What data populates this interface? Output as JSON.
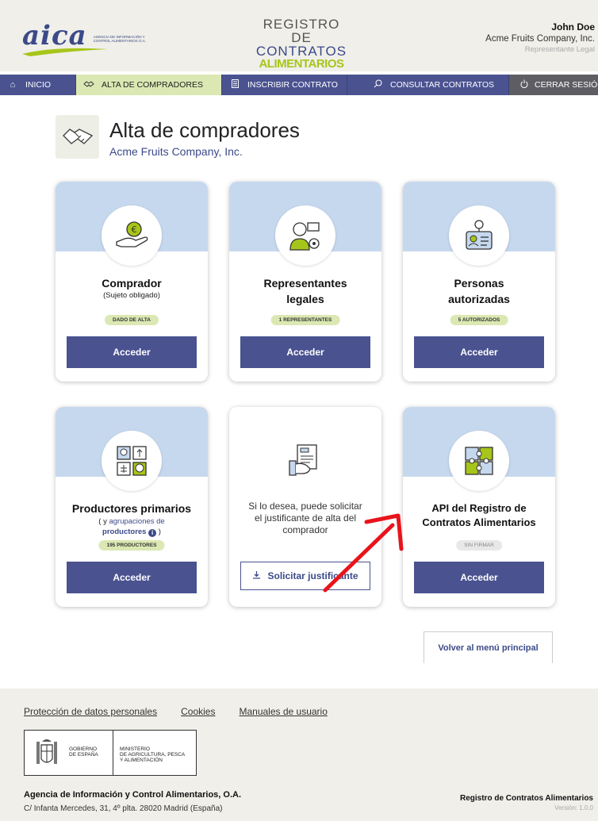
{
  "header": {
    "logo_text": "aica",
    "logo_subtitle": "Agencia de Información y Control Alimentarios O.A.",
    "brand_line1": "REGISTRO DE",
    "brand_line2": "CONTRATOS",
    "brand_line3": "ALIMENTARIOS",
    "user_name": "John Doe",
    "company": "Acme Fruits Company, Inc.",
    "role": "Representante Legal"
  },
  "nav": {
    "items": [
      {
        "label": "INICIO",
        "icon": "home-icon"
      },
      {
        "label": "ALTA DE COMPRADORES",
        "icon": "handshake-icon"
      },
      {
        "label": "INSCRIBIR CONTRATO",
        "icon": "document-icon"
      },
      {
        "label": "CONSULTAR CONTRATOS",
        "icon": "search-icon"
      },
      {
        "label": "CERRAR SESIÓN",
        "icon": "power-icon"
      }
    ]
  },
  "page": {
    "title": "Alta de compradores",
    "subtitle": "Acme Fruits Company, Inc."
  },
  "cards": {
    "comprador": {
      "title": "Comprador",
      "subtitle": "(Sujeto obligado)",
      "badge": "DADO DE ALTA",
      "button": "Acceder"
    },
    "representantes": {
      "title_line1": "Representantes",
      "title_line2": "legales",
      "badge": "1 REPRESENTANTES",
      "button": "Acceder"
    },
    "personas": {
      "title_line1": "Personas",
      "title_line2": "autorizadas",
      "badge": "5 AUTORIZADOS",
      "button": "Acceder"
    },
    "productores": {
      "title": "Productores primarios",
      "sub_prefix": "( y ",
      "sub_link1": "agrupaciones de",
      "sub_link2": "productores",
      "sub_suffix": " )",
      "badge": "195 PRODUCTORES",
      "button": "Acceder"
    },
    "justificante": {
      "text_line1": "Si lo desea, puede solicitar",
      "text_line2": "el justificante de alta del",
      "text_line3": "comprador",
      "button": "Solicitar justificante"
    },
    "api": {
      "title_line1": "API del Registro de",
      "title_line2": "Contratos Alimentarios",
      "badge": "SIN FIRMAR",
      "button": "Acceder"
    }
  },
  "back_button": "Volver al menú principal",
  "footer": {
    "links": [
      "Protección de datos personales",
      "Cookies",
      "Manuales de usuario"
    ],
    "gov_line1": "Gobierno",
    "gov_line2": "de España",
    "ministry_line1": "Ministerio",
    "ministry_line2": "de Agricultura, Pesca",
    "ministry_line3": "y Alimentación",
    "agency": "Agencia de Información y Control Alimentarios, O.A.",
    "address": "C/ Infanta Mercedes, 31, 4º plta. 28020 Madrid (España)",
    "registry": "Registro de Contratos Alimentarios",
    "version": "Versión: 1.0.0"
  },
  "colors": {
    "primary": "#4a5290",
    "accent_green": "#a6c51a",
    "band_blue": "#c6d8ee",
    "badge_green": "#dbe8b3",
    "annotation": "#e8141b"
  }
}
